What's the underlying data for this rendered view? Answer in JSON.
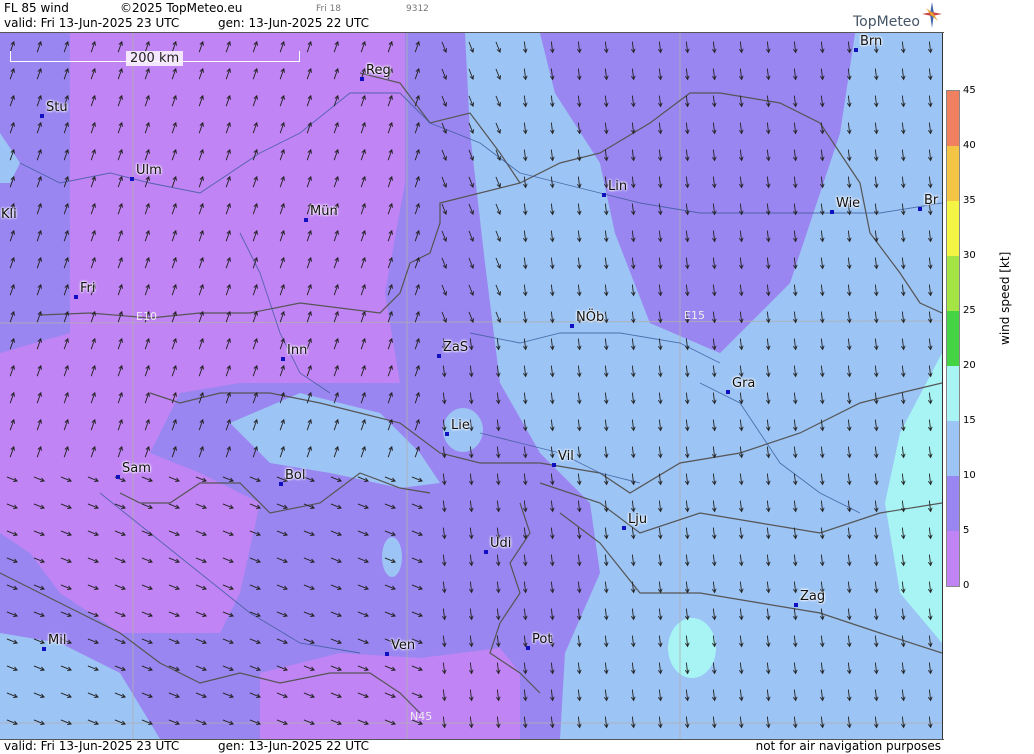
{
  "header": {
    "product": "FL 85 wind",
    "copyright": "©2025 TopMeteo.eu",
    "run_label": "Fri 18",
    "code": "9312",
    "valid": "valid:  Fri  13-Jun-2025  23 UTC",
    "generated": "gen: 13-Jun-2025 22 UTC",
    "brand": "TopMeteo"
  },
  "footer": {
    "valid": "valid:  Fri  13-Jun-2025  23 UTC",
    "generated": "gen: 13-Jun-2025 22 UTC",
    "disclaimer": "not for air navigation purposes"
  },
  "map": {
    "scale_label": "200 km",
    "grid_labels": [
      "E10",
      "E15",
      "N45"
    ],
    "cities": [
      {
        "name": "Stu"
      },
      {
        "name": "Ulm"
      },
      {
        "name": "Reg"
      },
      {
        "name": "Brn"
      },
      {
        "name": "Kli"
      },
      {
        "name": "Mün"
      },
      {
        "name": "Lin"
      },
      {
        "name": "Wie"
      },
      {
        "name": "Br"
      },
      {
        "name": "Fri"
      },
      {
        "name": "NÖb"
      },
      {
        "name": "Inn"
      },
      {
        "name": "ZaS"
      },
      {
        "name": "Gra"
      },
      {
        "name": "Lie"
      },
      {
        "name": "Vil"
      },
      {
        "name": "Sam"
      },
      {
        "name": "Bol"
      },
      {
        "name": "Lju"
      },
      {
        "name": "Udi"
      },
      {
        "name": "Zag"
      },
      {
        "name": "Mil"
      },
      {
        "name": "Ven"
      },
      {
        "name": "Pot"
      }
    ],
    "wind_direction": "north-to-south"
  },
  "legend": {
    "title": "wind  speed  [kt]",
    "unit": "kt",
    "ticks": [
      "45",
      "40",
      "35",
      "30",
      "25",
      "20",
      "15",
      "10",
      "5",
      "0"
    ],
    "colors": {
      "0-5": "#c084f4",
      "5-10": "#9a86f0",
      "10-15": "#9cc4f4",
      "15-20": "#a8f4f4",
      "20-25": "#44d444",
      "25-30": "#a4e444",
      "30-35": "#f4f444",
      "35-40": "#f4c444",
      "40-45": "#f08060"
    }
  }
}
